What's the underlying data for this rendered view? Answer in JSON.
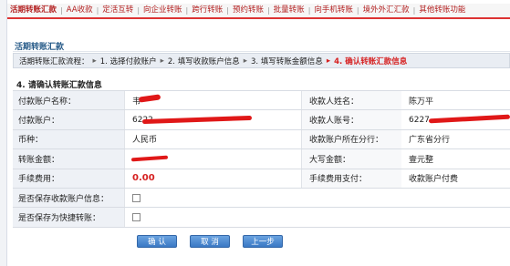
{
  "tabs": [
    {
      "label": "活期转账汇款",
      "active": true
    },
    {
      "label": "AA收款"
    },
    {
      "label": "定活互转"
    },
    {
      "label": "向企业转账"
    },
    {
      "label": "跨行转账"
    },
    {
      "label": "预约转账"
    },
    {
      "label": "批量转账"
    },
    {
      "label": "向手机转账"
    },
    {
      "label": "境外外汇汇款"
    },
    {
      "label": "其他转账功能"
    }
  ],
  "section_title": "活期转账汇款",
  "flow": {
    "label": "活期转账汇款流程：",
    "steps": [
      "1. 选择付款账户",
      "2. 填写收款账户信息",
      "3. 填写转账金额信息",
      "4. 确认转账汇款信息"
    ]
  },
  "step_title": "4. 请确认转账汇款信息",
  "form": {
    "payer_name_label": "付款账户名称：",
    "payer_name_value": "韦",
    "payee_name_label": "收款人姓名：",
    "payee_name_value": "陈万平",
    "payer_account_label": "付款账户：",
    "payer_account_value": "6222",
    "payee_account_label": "收款人账号：",
    "payee_account_value": "6227",
    "currency_label": "币种：",
    "currency_value": "人民币",
    "payee_branch_label": "收款账户所在分行：",
    "payee_branch_value": "广东省分行",
    "amount_label": "转账金额：",
    "amount_value": "",
    "amount_upper_label": "大写金额：",
    "amount_upper_value": "壹元整",
    "fee_label": "手续费用：",
    "fee_value": "0.00",
    "fee_payer_label": "手续费用支付：",
    "fee_payer_value": "收款账户付费",
    "save_payee_label": "是否保存收款账户信息：",
    "save_shortcut_label": "是否保存为快捷转账："
  },
  "buttons": {
    "confirm": "确 认",
    "cancel": "取 消",
    "back": "上一步"
  },
  "colors": {
    "tab_text": "#b42222",
    "accent_red": "#d62020",
    "button_blue": "#3a78c4",
    "section_blue": "#2a5d8a"
  }
}
